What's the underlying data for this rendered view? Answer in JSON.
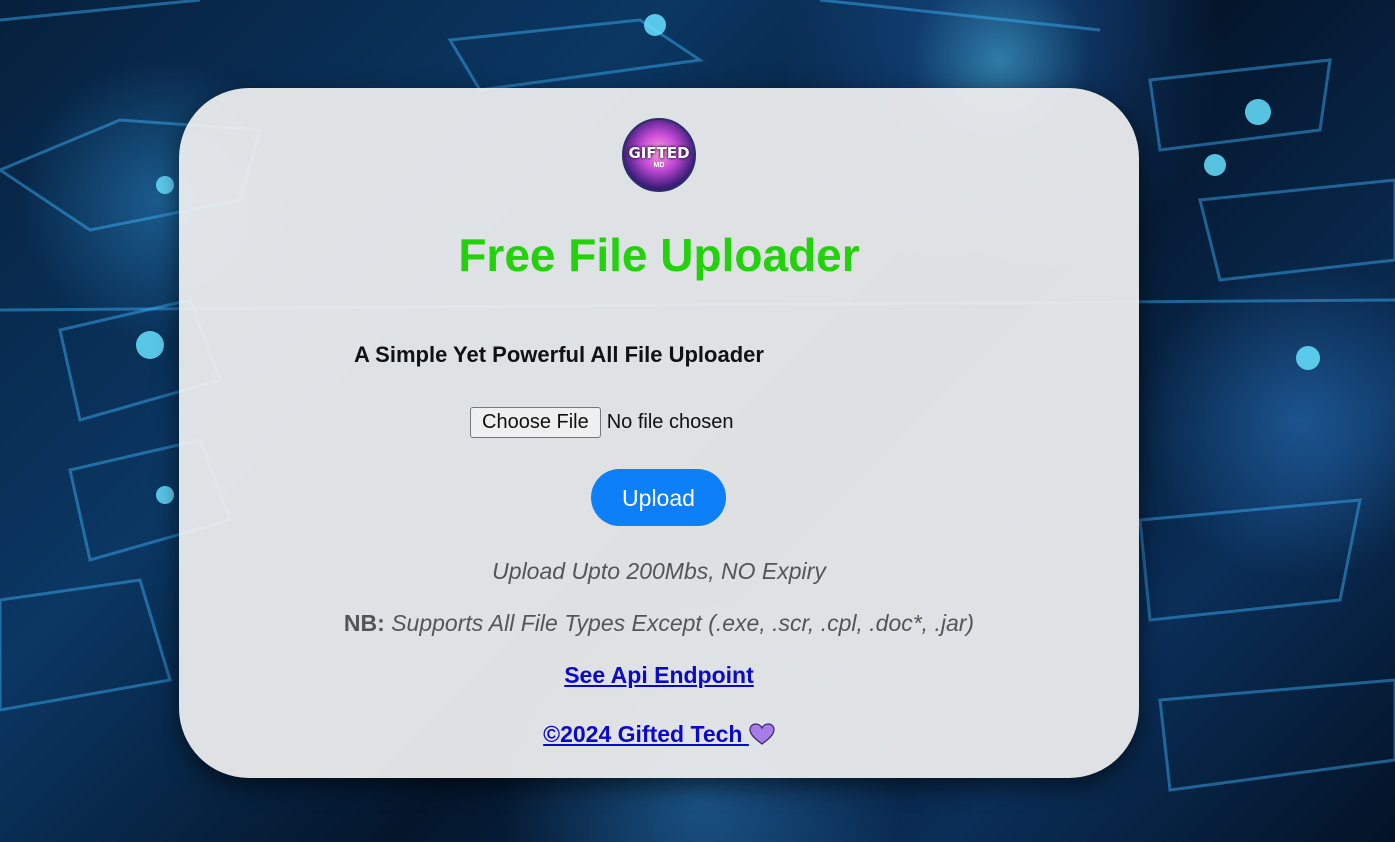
{
  "background": {
    "icon": "circuit-board-background"
  },
  "card": {
    "logo": {
      "icon": "gifted-md-logo-icon",
      "text": "GIFTED",
      "subtext": "MD"
    },
    "title": "Free File Uploader",
    "subtitle": "A Simple Yet Powerful All File Uploader",
    "file_input": {
      "button_label": "Choose File",
      "status": "No file chosen"
    },
    "upload_button": "Upload",
    "limit_note": "Upload Upto 200Mbs, NO Expiry",
    "nb_label": "NB:",
    "nb_text": "Supports All File Types Except (.exe, .scr, .cpl, .doc*, .jar)",
    "api_link": "See Api Endpoint",
    "footer_link": "©2024 Gifted Tech",
    "footer_icon": "purple-heart-icon"
  },
  "colors": {
    "title": "#24d10d",
    "upload_button": "#0d7ff8",
    "link": "#0a0ac8",
    "heart": "#a97be8"
  }
}
